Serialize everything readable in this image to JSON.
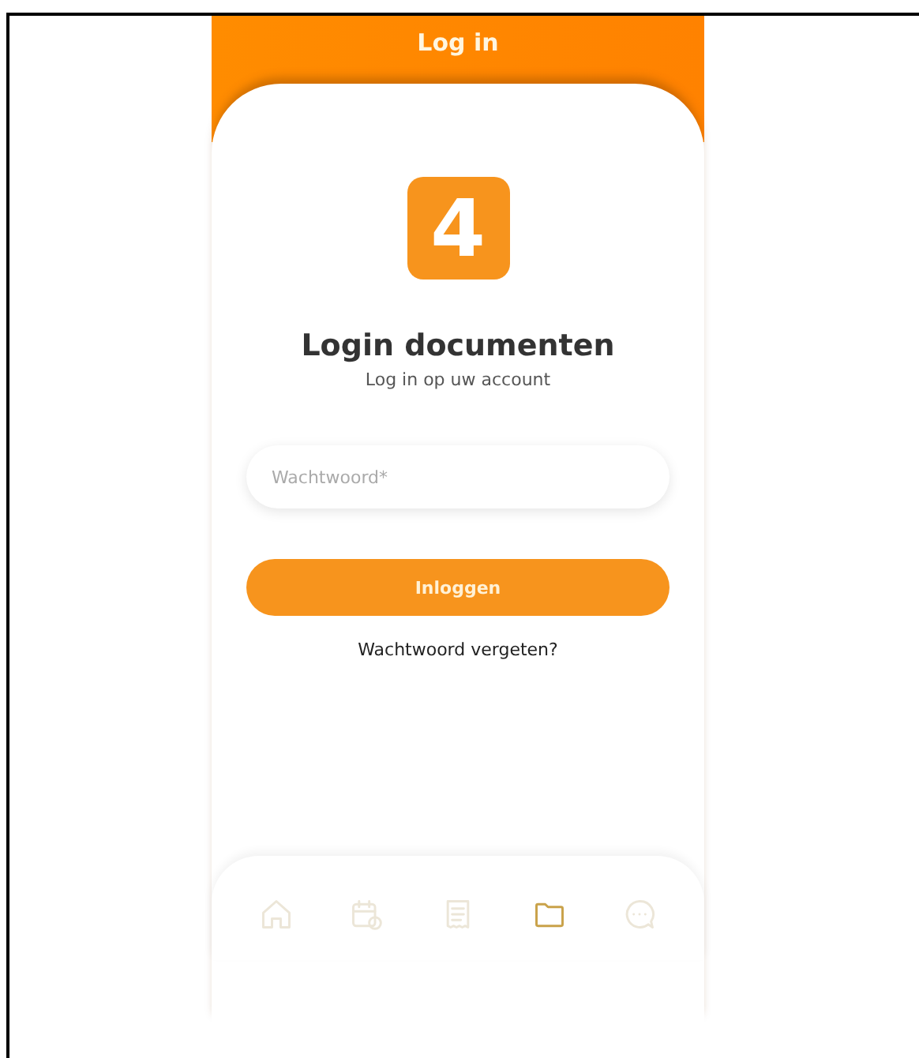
{
  "header": {
    "title": "Log in"
  },
  "logo": {
    "text": "4"
  },
  "title": "Login documenten",
  "subtitle": "Log in op uw account",
  "password_field": {
    "placeholder": "Wachtwoord*"
  },
  "login_button": "Inloggen",
  "forgot_link": "Wachtwoord vergeten?",
  "nav": [
    {
      "kind": "home",
      "selected": false
    },
    {
      "kind": "calendar",
      "selected": false
    },
    {
      "kind": "receipt",
      "selected": false
    },
    {
      "kind": "folder",
      "selected": true
    },
    {
      "kind": "chat",
      "selected": false
    }
  ]
}
